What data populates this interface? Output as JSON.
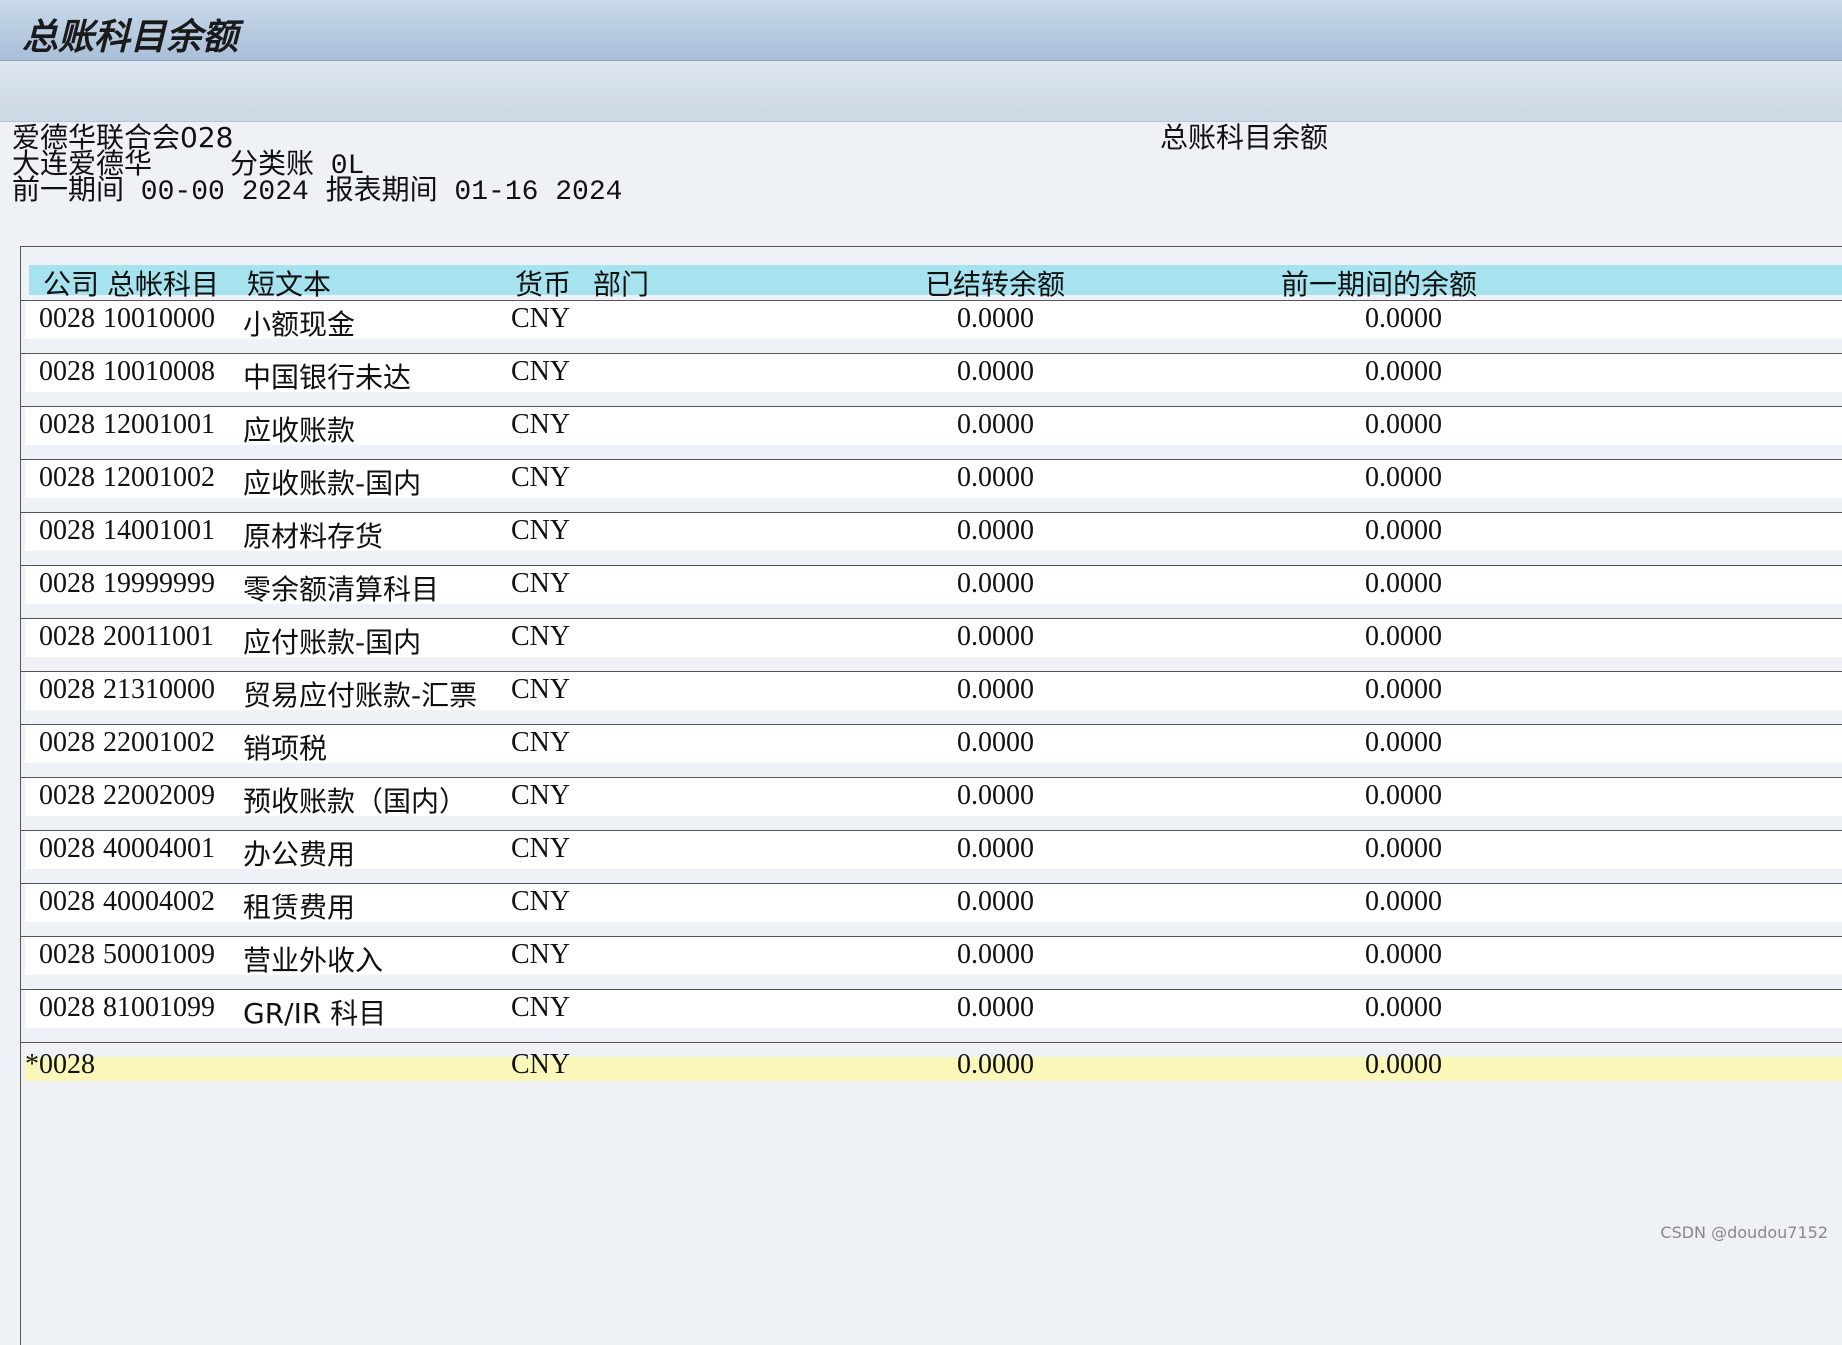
{
  "window": {
    "title": "总账科目余额"
  },
  "report_header": {
    "company_line": "爱德华联合会028",
    "report_title": "总账科目余额",
    "entity_name": "大连爱德华",
    "ledger_label": "分类账 0L",
    "period_line": "前一期间 00-00 2024 报表期间 01-16 2024"
  },
  "columns": {
    "company": "公司",
    "gl_account": "总帐科目",
    "short_text": "短文本",
    "currency": "货币",
    "department": "部门",
    "carried_forward": "已结转余额",
    "prev_period_balance": "前一期间的余额"
  },
  "rows": [
    {
      "company": "0028",
      "account": "10010000",
      "text": "小额现金",
      "currency": "CNY",
      "carried": "0.0000",
      "prev": "0.0000"
    },
    {
      "company": "0028",
      "account": "10010008",
      "text": "中国银行未达",
      "currency": "CNY",
      "carried": "0.0000",
      "prev": "0.0000"
    },
    {
      "company": "0028",
      "account": "12001001",
      "text": "应收账款",
      "currency": "CNY",
      "carried": "0.0000",
      "prev": "0.0000"
    },
    {
      "company": "0028",
      "account": "12001002",
      "text": "应收账款-国内",
      "currency": "CNY",
      "carried": "0.0000",
      "prev": "0.0000"
    },
    {
      "company": "0028",
      "account": "14001001",
      "text": "原材料存货",
      "currency": "CNY",
      "carried": "0.0000",
      "prev": "0.0000"
    },
    {
      "company": "0028",
      "account": "19999999",
      "text": "零余额清算科目",
      "currency": "CNY",
      "carried": "0.0000",
      "prev": "0.0000"
    },
    {
      "company": "0028",
      "account": "20011001",
      "text": "应付账款-国内",
      "currency": "CNY",
      "carried": "0.0000",
      "prev": "0.0000"
    },
    {
      "company": "0028",
      "account": "21310000",
      "text": "贸易应付账款-汇票",
      "currency": "CNY",
      "carried": "0.0000",
      "prev": "0.0000"
    },
    {
      "company": "0028",
      "account": "22001002",
      "text": "销项税",
      "currency": "CNY",
      "carried": "0.0000",
      "prev": "0.0000"
    },
    {
      "company": "0028",
      "account": "22002009",
      "text": "预收账款（国内）",
      "currency": "CNY",
      "carried": "0.0000",
      "prev": "0.0000"
    },
    {
      "company": "0028",
      "account": "40004001",
      "text": "办公费用",
      "currency": "CNY",
      "carried": "0.0000",
      "prev": "0.0000"
    },
    {
      "company": "0028",
      "account": "40004002",
      "text": "租赁费用",
      "currency": "CNY",
      "carried": "0.0000",
      "prev": "0.0000"
    },
    {
      "company": "0028",
      "account": "50001009",
      "text": "营业外收入",
      "currency": "CNY",
      "carried": "0.0000",
      "prev": "0.0000"
    },
    {
      "company": "0028",
      "account": "81001099",
      "text": "GR/IR 科目",
      "currency": "CNY",
      "carried": "0.0000",
      "prev": "0.0000"
    }
  ],
  "total_row": {
    "company": "*0028",
    "currency": "CNY",
    "carried": "0.0000",
    "prev": "0.0000"
  },
  "watermark": "CSDN @doudou7152"
}
